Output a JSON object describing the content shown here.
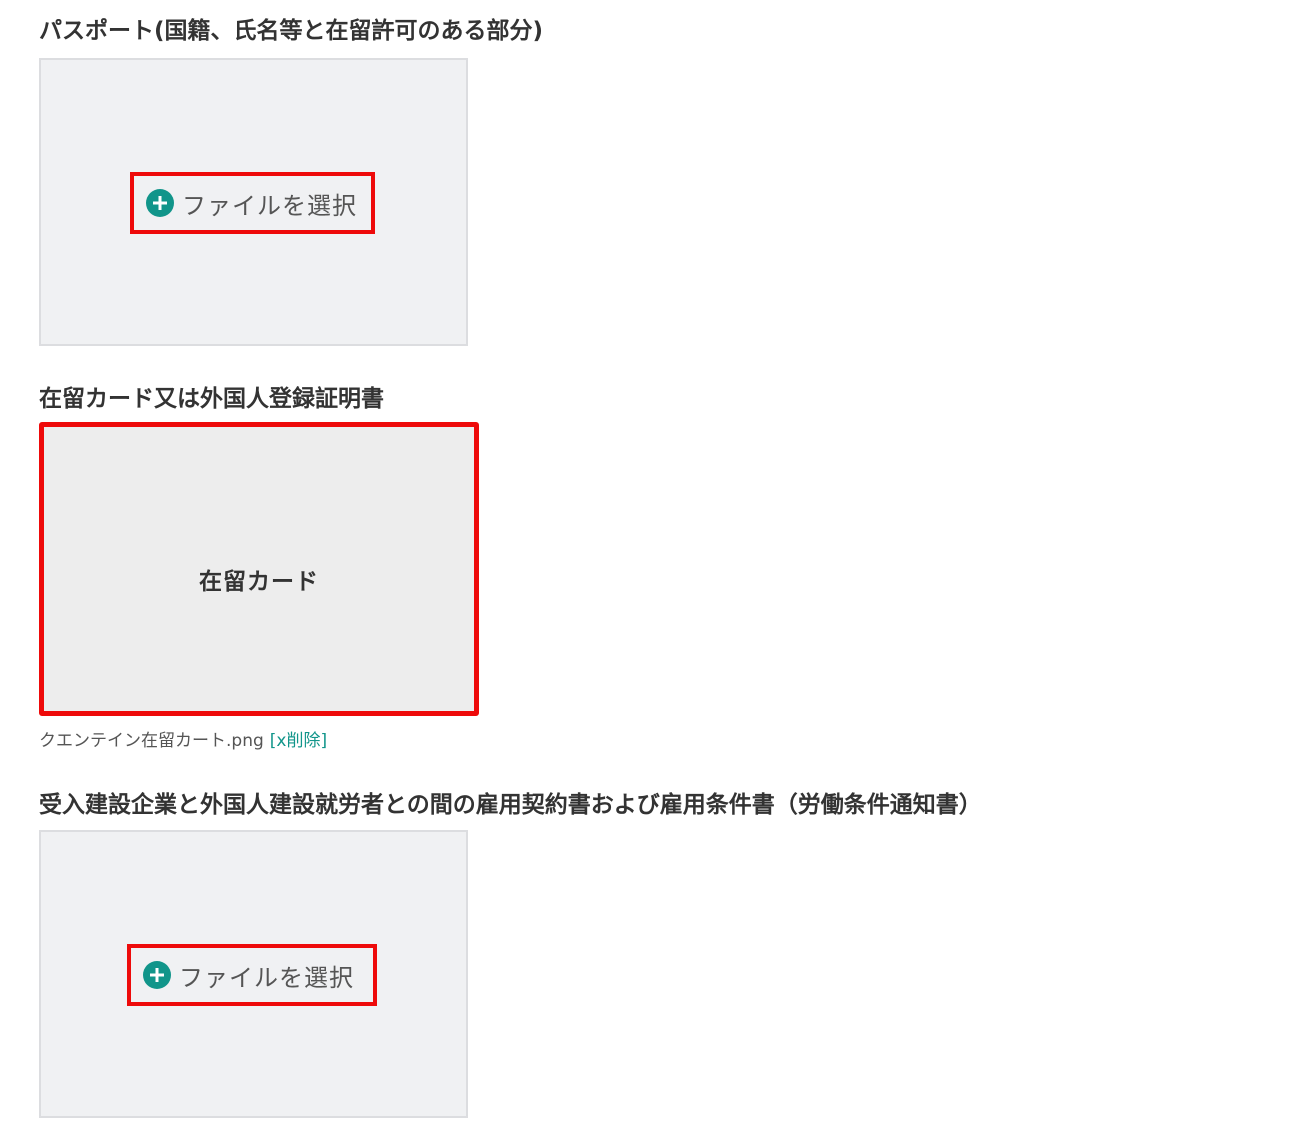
{
  "sections": [
    {
      "title": "パスポート(国籍、氏名等と在留許可のある部分)",
      "file_button_label": "ファイルを選択"
    },
    {
      "title": "在留カード又は外国人登録証明書",
      "preview_text": "在留カード",
      "file_name": "クエンテイン在留カート.png",
      "delete_label": "[x削除]"
    },
    {
      "title": "受入建設企業と外国人建設就労者との間の雇用契約書および雇用条件書（労働条件通知書）",
      "file_button_label": "ファイルを選択"
    }
  ],
  "colors": {
    "accent": "#11958a",
    "highlight": "#ee0a0a",
    "box_background": "#f0f1f3"
  },
  "icons": [
    "plus-circle-icon"
  ]
}
